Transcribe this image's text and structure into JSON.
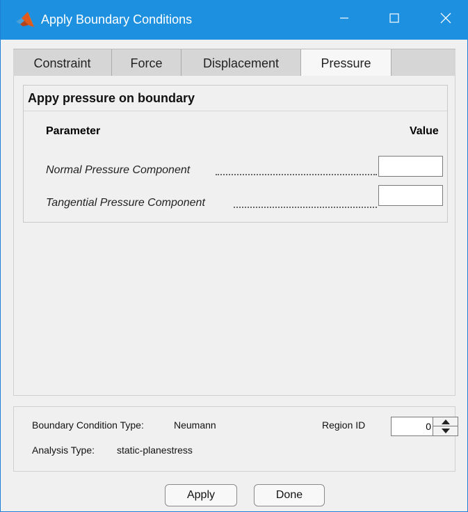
{
  "window": {
    "title": "Apply Boundary Conditions"
  },
  "tabs": [
    {
      "label": "Constraint"
    },
    {
      "label": "Force"
    },
    {
      "label": "Displacement"
    },
    {
      "label": "Pressure",
      "active": true
    }
  ],
  "pressure_panel": {
    "group_title": "Appy pressure on boundary",
    "header_parameter": "Parameter",
    "header_value": "Value",
    "rows": [
      {
        "label": "Normal Pressure Component",
        "value": ""
      },
      {
        "label": "Tangential Pressure Component",
        "value": ""
      }
    ]
  },
  "status": {
    "bc_type_label": "Boundary Condition Type:",
    "bc_type_value": "Neumann",
    "analysis_type_label": "Analysis Type:",
    "analysis_type_value": "static-planestress",
    "region_id_label": "Region ID",
    "region_id_value": "0"
  },
  "buttons": {
    "apply_label": "Apply",
    "done_label": "Done"
  },
  "colors": {
    "titlebar": "#1e90e0",
    "tabstrip": "#d6d6d6",
    "active_tab": "#f7f7f7",
    "background": "#f0f0f0"
  },
  "icons": [
    "matlab-logo-icon",
    "minimize-icon",
    "maximize-icon",
    "close-icon",
    "spinner-up-icon",
    "spinner-down-icon"
  ]
}
